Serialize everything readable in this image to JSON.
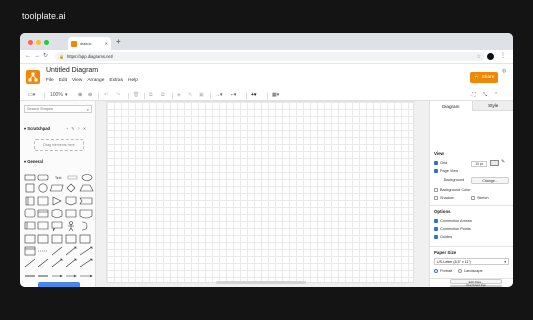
{
  "brand": "toolplate.ai",
  "browser": {
    "tab_title": "draw.io",
    "url": "https://app.diagrams.net/",
    "traffic_colors": [
      "#ff5f57",
      "#febc2e",
      "#28c840"
    ]
  },
  "app": {
    "title": "Untitled Diagram",
    "menus": [
      "File",
      "Edit",
      "View",
      "Arrange",
      "Extras",
      "Help"
    ],
    "share_label": "Share",
    "accent": "#f08705"
  },
  "toolbar": {
    "zoom": "100%"
  },
  "left": {
    "search_placeholder": "Search Shapes",
    "scratchpad_label": "Scratchpad",
    "drag_hint": "Drag elements here",
    "general_label": "General"
  },
  "right": {
    "tab_diagram": "Diagram",
    "tab_style": "Style",
    "view_label": "View",
    "grid_label": "Grid",
    "grid_size": "10 pt",
    "page_view_label": "Page View",
    "background_label": "Background",
    "change_label": "Change...",
    "background_color_label": "Background Color",
    "shadow_label": "Shadow",
    "sketch_label": "Sketch",
    "options_label": "Options",
    "connection_arrows_label": "Connection Arrows",
    "connection_points_label": "Connection Points",
    "guides_label": "Guides",
    "paper_size_label": "Paper Size",
    "paper_size_value": "US-Letter (8,5\" x 11\")",
    "portrait_label": "Portrait",
    "landscape_label": "Landscape",
    "edit_data_label": "Edit Data...",
    "clear_default_style_label": "Clear Default Style"
  }
}
